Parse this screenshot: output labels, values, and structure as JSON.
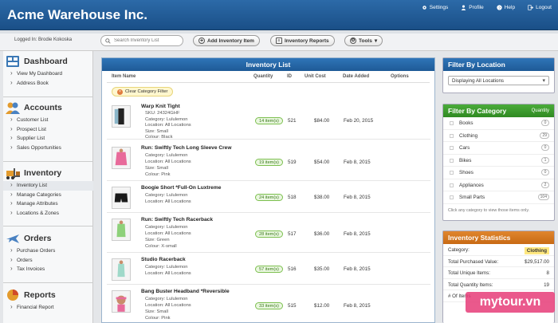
{
  "app": {
    "title": "Acme Warehouse Inc."
  },
  "header_links": [
    {
      "label": "Settings",
      "icon": "gear-icon"
    },
    {
      "label": "Profile",
      "icon": "user-icon"
    },
    {
      "label": "Help",
      "icon": "help-icon"
    },
    {
      "label": "Logout",
      "icon": "logout-icon"
    }
  ],
  "toolbar": {
    "logged_in": "Logged In: Brodie Kokoska",
    "search_placeholder": "Search Inventory List",
    "add_item": "Add Inventory Item",
    "reports": "Inventory Reports",
    "tools": "Tools"
  },
  "sidebar": {
    "dashboard": {
      "title": "Dashboard",
      "items": [
        "View My Dashboard",
        "Address Book"
      ]
    },
    "accounts": {
      "title": "Accounts",
      "items": [
        "Customer List",
        "Prospect List",
        "Supplier List",
        "Sales Opportunities"
      ]
    },
    "inventory": {
      "title": "Inventory",
      "items": [
        "Inventory List",
        "Manage Categories",
        "Manage Attributes",
        "Locations & Zones"
      ]
    },
    "orders": {
      "title": "Orders",
      "items": [
        "Purchase Orders",
        "Orders",
        "Tax Invoices"
      ]
    },
    "reports": {
      "title": "Reports",
      "items": [
        "Financial Report"
      ]
    }
  },
  "inventory": {
    "title": "Inventory List",
    "columns": {
      "name": "Item Name",
      "quantity": "Quantity",
      "id": "ID",
      "cost": "Unit Cost",
      "date": "Date Added",
      "options": "Options"
    },
    "clear_filter": "Clear Category Filter",
    "rows": [
      {
        "name": "Warp Knit Tight",
        "details": [
          "SKU: 24324GHF",
          "Category: Lululemon",
          "Location: All Locations",
          "Size: Small",
          "Colour: Black"
        ],
        "qty": "14 item(s)",
        "id": "521",
        "cost": "$84.00",
        "date": "Feb 20, 2015"
      },
      {
        "name": "Run: Swiftly Tech Long Sleeve Crew",
        "details": [
          "Category: Lululemon",
          "Location: All Locations",
          "Size: Small",
          "Colour: Pink"
        ],
        "qty": "19 item(s)",
        "id": "519",
        "cost": "$54.00",
        "date": "Feb 8, 2015"
      },
      {
        "name": "Boogie Short *Full-On Luxtreme",
        "details": [
          "Category: Lululemon",
          "Location: All Locations"
        ],
        "qty": "24 item(s)",
        "id": "518",
        "cost": "$38.00",
        "date": "Feb 8, 2015"
      },
      {
        "name": "Run: Swiftly Tech Racerback",
        "details": [
          "Category: Lululemon",
          "Location: All Locations",
          "Size: Green",
          "Colour: X-small"
        ],
        "qty": "28 item(s)",
        "id": "517",
        "cost": "$36.00",
        "date": "Feb 8, 2015"
      },
      {
        "name": "Studio Racerback",
        "details": [
          "Category: Lululemon",
          "Location: All Locations"
        ],
        "qty": "57 item(s)",
        "id": "516",
        "cost": "$35.00",
        "date": "Feb 8, 2015"
      },
      {
        "name": "Bang Buster Headband *Reversible",
        "details": [
          "Category: Lululemon",
          "Location: All Locations",
          "Size: Small",
          "Colour: Pink"
        ],
        "qty": "33 item(s)",
        "id": "515",
        "cost": "$12.00",
        "date": "Feb 8, 2015"
      }
    ]
  },
  "location_filter": {
    "title": "Filter By Location",
    "selected": "Displaying All Locations"
  },
  "category_filter": {
    "title": "Filter By Category",
    "qty_label": "Quantity",
    "categories": [
      {
        "name": "Books",
        "count": "0"
      },
      {
        "name": "Clothing",
        "count": "29"
      },
      {
        "name": "Cars",
        "count": "0"
      },
      {
        "name": "Bikes",
        "count": "1"
      },
      {
        "name": "Shoes",
        "count": "0"
      },
      {
        "name": "Appliances",
        "count": "2"
      },
      {
        "name": "Small Parts",
        "count": "104"
      }
    ],
    "note": "Click any category to view those items only."
  },
  "stats": {
    "title": "Inventory Statistics",
    "rows": [
      {
        "label": "Category:",
        "value": "Clothing"
      },
      {
        "label": "Total Purchased Value:",
        "value": "$29,517.00"
      },
      {
        "label": "Total Unique Items:",
        "value": "8"
      },
      {
        "label": "Total Quantity Items:",
        "value": "19"
      },
      {
        "label": "# Of Items",
        "value": ""
      }
    ]
  },
  "watermark": "mytour.vn",
  "colors": {
    "header_blue": "#1e5a96",
    "category_green": "#2f8a22",
    "stats_orange": "#c86a14",
    "qty_badge": "#7cbf4f"
  }
}
